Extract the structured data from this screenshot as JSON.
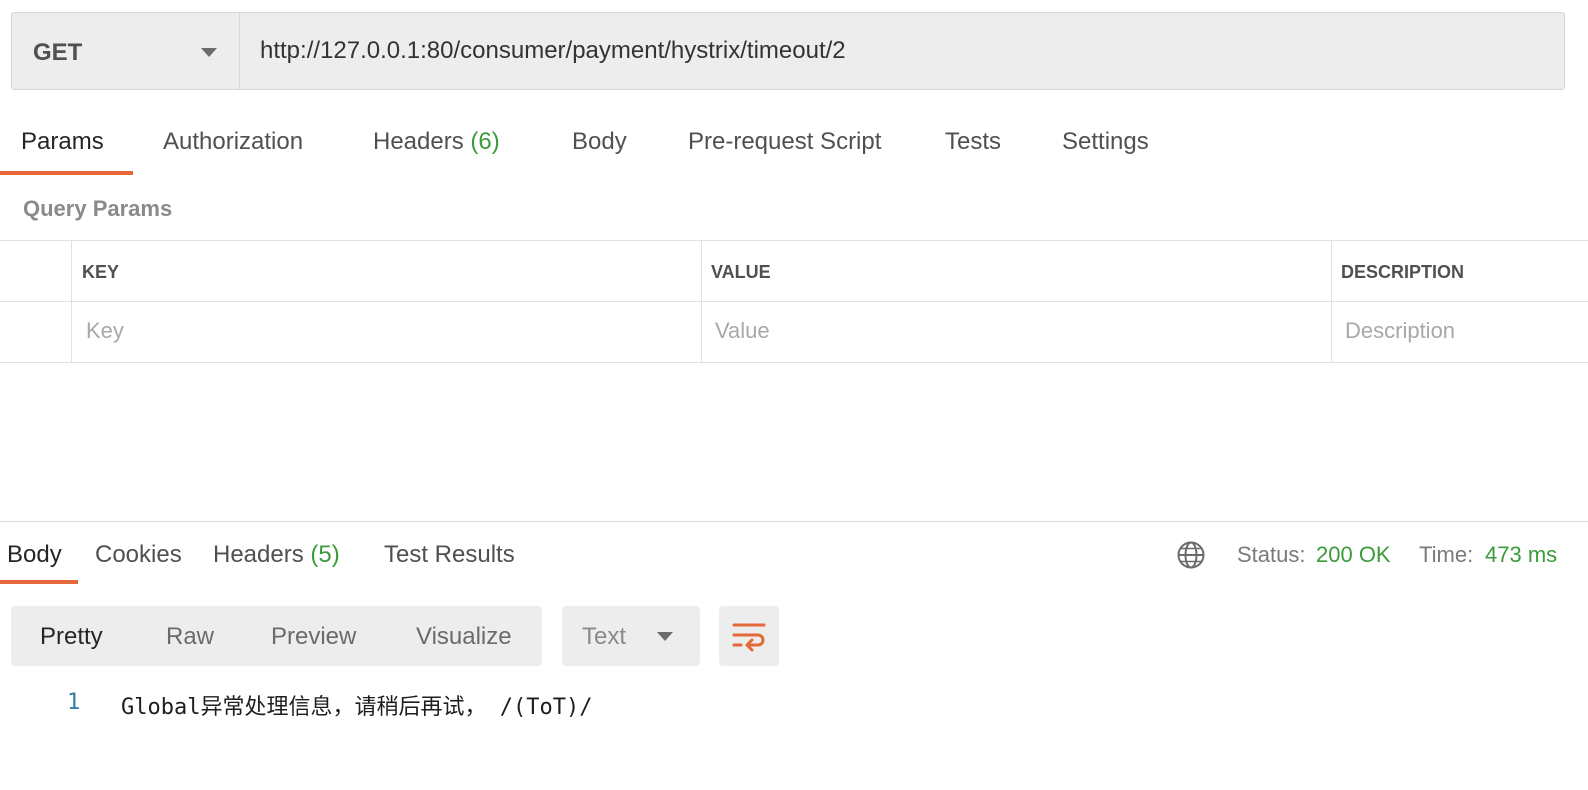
{
  "request": {
    "method": "GET",
    "url": "http://127.0.0.1:80/consumer/payment/hystrix/timeout/2"
  },
  "request_tabs": [
    {
      "label": "Params",
      "count": ""
    },
    {
      "label": "Authorization",
      "count": ""
    },
    {
      "label": "Headers",
      "count": "(6)"
    },
    {
      "label": "Body",
      "count": ""
    },
    {
      "label": "Pre-request Script",
      "count": ""
    },
    {
      "label": "Tests",
      "count": ""
    },
    {
      "label": "Settings",
      "count": ""
    }
  ],
  "query_params": {
    "title": "Query Params",
    "columns": [
      "KEY",
      "VALUE",
      "DESCRIPTION"
    ],
    "placeholders": [
      "Key",
      "Value",
      "Description"
    ]
  },
  "response_tabs": [
    {
      "label": "Body",
      "count": ""
    },
    {
      "label": "Cookies",
      "count": ""
    },
    {
      "label": "Headers",
      "count": "(5)"
    },
    {
      "label": "Test Results",
      "count": ""
    }
  ],
  "response_meta": {
    "status_label": "Status:",
    "status_value": "200 OK",
    "time_label": "Time:",
    "time_value": "473 ms"
  },
  "body_view": {
    "modes": [
      "Pretty",
      "Raw",
      "Preview",
      "Visualize"
    ],
    "format": "Text"
  },
  "response_body": {
    "lines": [
      {
        "number": "1",
        "text": "Global异常处理信息，请稍后再试， /(ToT)/"
      }
    ]
  },
  "colors": {
    "accent": "#e5683a",
    "success": "#3b9b3b"
  }
}
